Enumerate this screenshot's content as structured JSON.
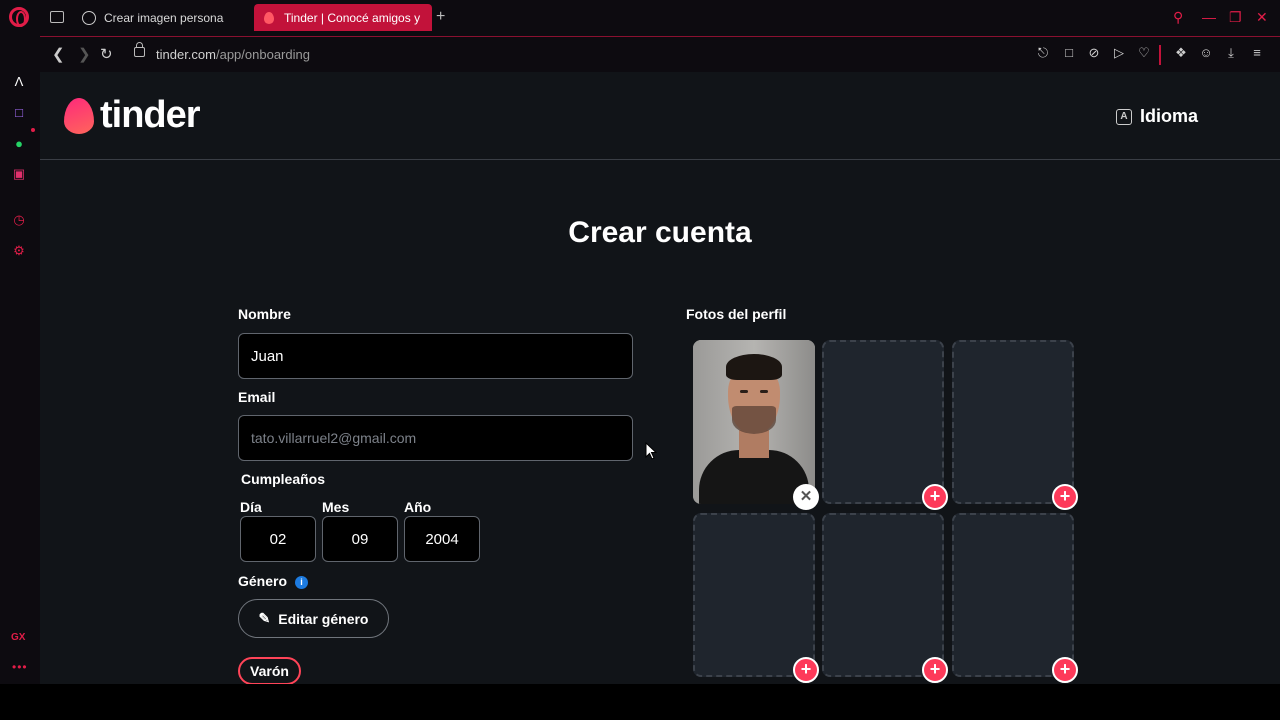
{
  "browser": {
    "tabs": [
      {
        "label": "Crear imagen persona"
      },
      {
        "label": "Tinder | Conocé amigos y"
      }
    ],
    "url_host": "tinder.com",
    "url_path": "/app/onboarding",
    "sidebar_gx": "GX"
  },
  "header": {
    "logo_text": "tinder",
    "language_label": "Idioma"
  },
  "page_title": "Crear cuenta",
  "form": {
    "name_label": "Nombre",
    "name_value": "Juan",
    "email_label": "Email",
    "email_placeholder": "tato.villarruel2@gmail.com",
    "birthday_label": "Cumpleaños",
    "day_label": "Día",
    "day_value": "02",
    "month_label": "Mes",
    "month_value": "09",
    "year_label": "Año",
    "year_value": "2004",
    "gender_label": "Género",
    "edit_gender_label": "Editar género",
    "gender_value": "Varón"
  },
  "photos": {
    "label": "Fotos del perfil"
  },
  "colors": {
    "accent": "#fd3a5a",
    "browser_accent": "#e11d48",
    "page_bg": "#111418",
    "info": "#1d7be0"
  }
}
